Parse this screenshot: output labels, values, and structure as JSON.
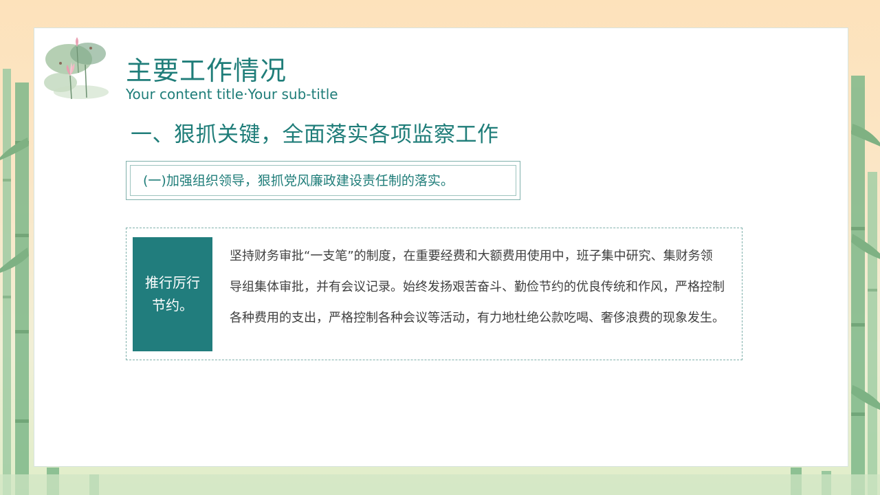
{
  "header": {
    "title": "主要工作情况",
    "subtitle": "Your content title·Your sub-title"
  },
  "section": {
    "heading": "一、狠抓关键，全面落实各项监察工作",
    "subheading": "(一)加强组织领导，狠抓党风廉政建设责任制的落实。"
  },
  "content": {
    "label": "推行厉行节约。",
    "body": "坚持财务审批“一支笔”的制度，在重要经费和大额费用使用中，班子集中研究、集财务领导组集体审批，并有会议记录。始终发扬艰苦奋斗、勤俭节约的优良传统和作风，严格控制各种费用的支出，严格控制各种会议等活动，有力地杜绝公款吃喝、奢侈浪费的现象发生。"
  },
  "colors": {
    "accent": "#1f7d79",
    "label_block": "#217d7d",
    "body_text": "#404040"
  },
  "icons": {
    "decoration": "lotus-painting-icon",
    "background": "bamboo-background"
  }
}
